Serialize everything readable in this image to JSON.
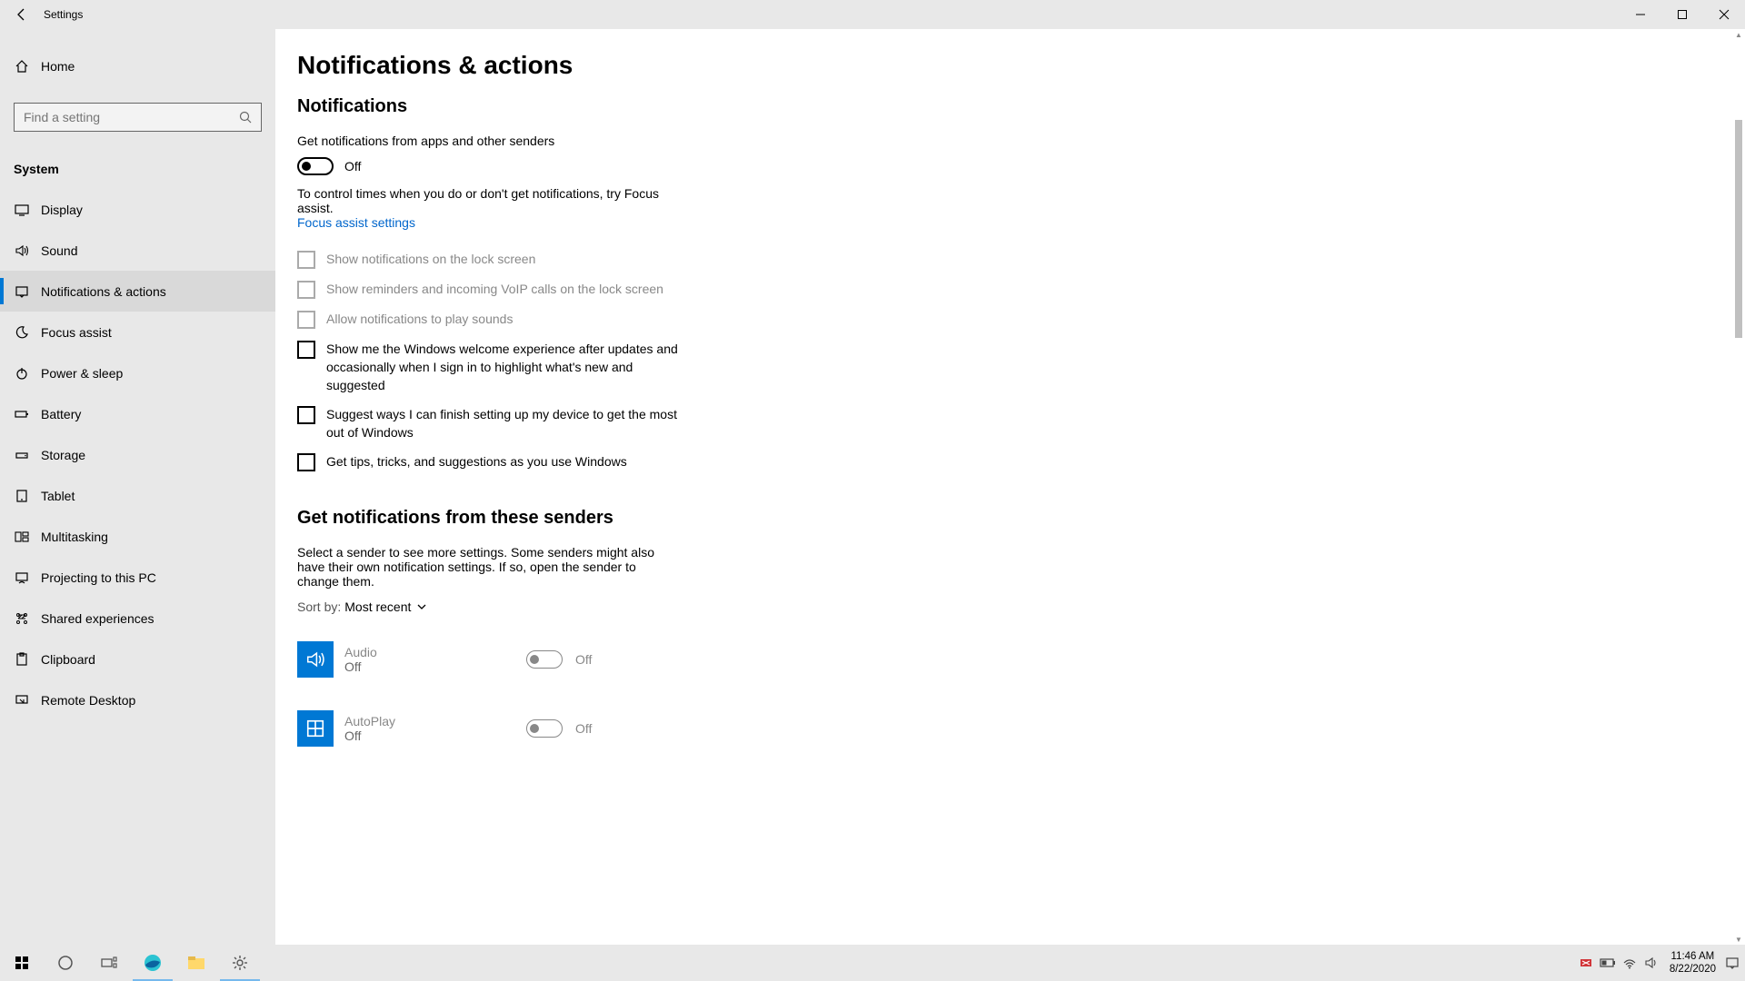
{
  "titlebar": {
    "title": "Settings"
  },
  "sidebar": {
    "home": "Home",
    "search_placeholder": "Find a setting",
    "section": "System",
    "items": [
      {
        "label": "Display"
      },
      {
        "label": "Sound"
      },
      {
        "label": "Notifications & actions"
      },
      {
        "label": "Focus assist"
      },
      {
        "label": "Power & sleep"
      },
      {
        "label": "Battery"
      },
      {
        "label": "Storage"
      },
      {
        "label": "Tablet"
      },
      {
        "label": "Multitasking"
      },
      {
        "label": "Projecting to this PC"
      },
      {
        "label": "Shared experiences"
      },
      {
        "label": "Clipboard"
      },
      {
        "label": "Remote Desktop"
      }
    ]
  },
  "page": {
    "title": "Notifications & actions",
    "section_notifications": "Notifications",
    "get_notifications_label": "Get notifications from apps and other senders",
    "toggle_state": "Off",
    "focus_hint": "To control times when you do or don't get notifications, try Focus assist.",
    "focus_link": "Focus assist settings",
    "checks": [
      {
        "label": "Show notifications on the lock screen",
        "disabled": true
      },
      {
        "label": "Show reminders and incoming VoIP calls on the lock screen",
        "disabled": true
      },
      {
        "label": "Allow notifications to play sounds",
        "disabled": true
      },
      {
        "label": "Show me the Windows welcome experience after updates and occasionally when I sign in to highlight what's new and suggested",
        "disabled": false
      },
      {
        "label": "Suggest ways I can finish setting up my device to get the most out of Windows",
        "disabled": false
      },
      {
        "label": "Get tips, tricks, and suggestions as you use Windows",
        "disabled": false
      }
    ],
    "section_senders": "Get notifications from these senders",
    "senders_hint": "Select a sender to see more settings. Some senders might also have their own notification settings. If so, open the sender to change them.",
    "sort_label": "Sort by:",
    "sort_value": "Most recent",
    "senders": [
      {
        "name": "Audio",
        "status": "Off",
        "toggle": "Off"
      },
      {
        "name": "AutoPlay",
        "status": "Off",
        "toggle": "Off"
      }
    ]
  },
  "taskbar": {
    "time": "11:46 AM",
    "date": "8/22/2020"
  }
}
